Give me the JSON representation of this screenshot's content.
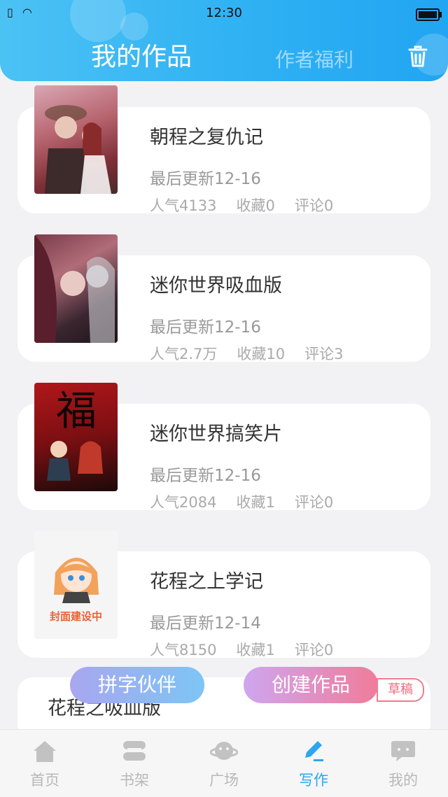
{
  "status_bar": {
    "time": "12:30"
  },
  "header": {
    "title": "我的作品",
    "welfare_label": "作者福利",
    "trash_icon": "trash-icon"
  },
  "works": [
    {
      "title": "朝程之复仇记",
      "updated": "最后更新12-16",
      "popularity": "人气4133",
      "favorites": "收藏0",
      "comments": "评论0"
    },
    {
      "title": "迷你世界吸血版",
      "updated": "最后更新12-16",
      "popularity": "人气2.7万",
      "favorites": "收藏10",
      "comments": "评论3"
    },
    {
      "title": "迷你世界搞笑片",
      "updated": "最后更新12-16",
      "popularity": "人气2084",
      "favorites": "收藏1",
      "comments": "评论0"
    },
    {
      "title": "花程之上学记",
      "updated": "最后更新12-14",
      "popularity": "人气8150",
      "favorites": "收藏1",
      "comments": "评论0",
      "cover_text": "封面建设中"
    },
    {
      "title": "花程之吸血版"
    }
  ],
  "actions": {
    "partner_label": "拼字伙伴",
    "create_label": "创建作品",
    "draft_label": "草稿"
  },
  "tabs": [
    {
      "label": "首页",
      "icon": "home-icon"
    },
    {
      "label": "书架",
      "icon": "bookshelf-icon"
    },
    {
      "label": "广场",
      "icon": "planet-icon"
    },
    {
      "label": "写作",
      "icon": "pen-icon",
      "active": true
    },
    {
      "label": "我的",
      "icon": "chat-bubble-icon"
    }
  ],
  "colors": {
    "accent": "#2aa7f1",
    "header_gradient_start": "#4cc2f4",
    "create_gradient_end": "#f07c9a"
  }
}
